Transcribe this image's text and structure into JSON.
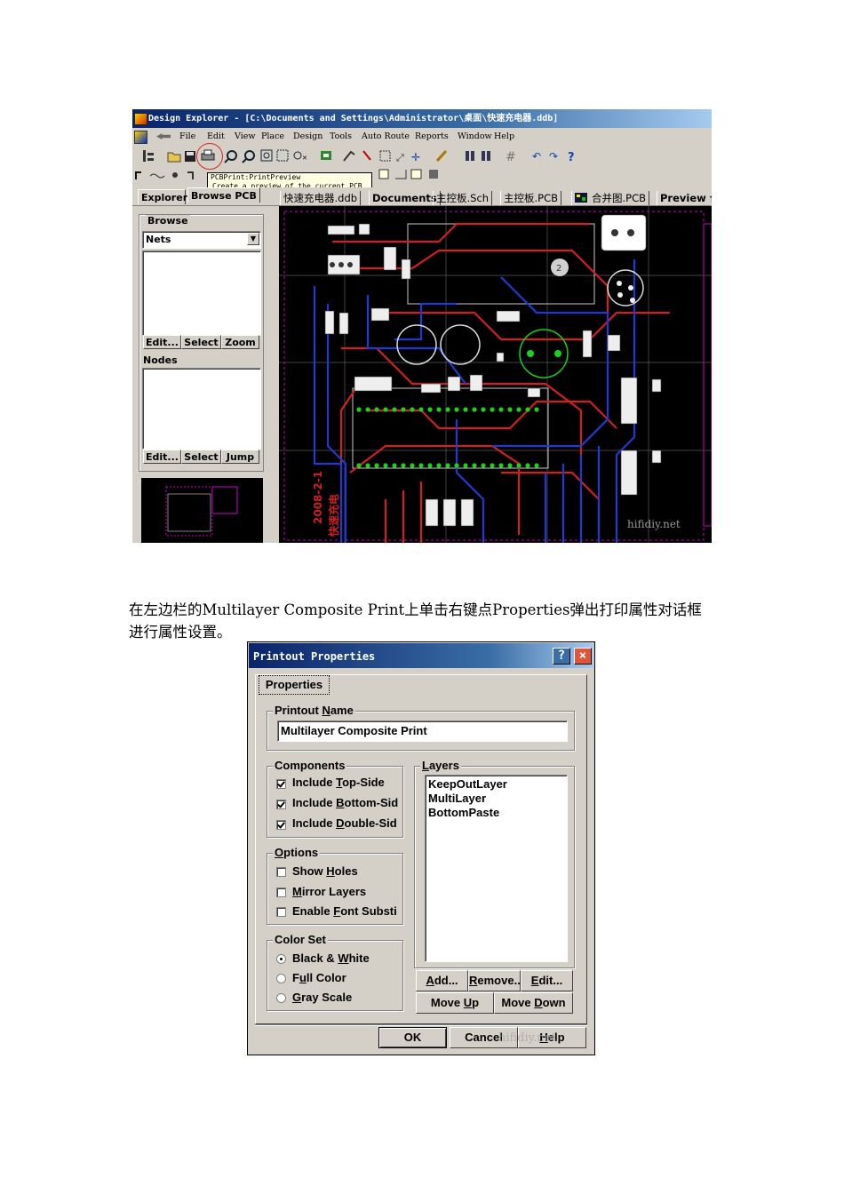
{
  "screenshot1": {
    "title": "Design Explorer - [C:\\Documents and Settings\\Administrator\\桌面\\快速充电器.ddb]",
    "menu": [
      "File",
      "Edit",
      "View",
      "Place",
      "Design",
      "Tools",
      "Auto Route",
      "Reports",
      "Window",
      "Help"
    ],
    "tooltip": {
      "line1": "PCBPrint:PrintPreview",
      "line2": "Create a preview of the current PCB"
    },
    "panel_tabs": [
      "Explorer",
      "Browse PCB"
    ],
    "doc_tabs": [
      "快速充电器.ddb",
      "Documents",
      "主控板.Sch",
      "主控板.PCB",
      "合并图.PCB",
      "Preview 合"
    ],
    "browse": {
      "label": "Browse",
      "selected": "Nets",
      "buttons": [
        "Edit...",
        "Select",
        "Zoom"
      ],
      "nodes_label": "Nodes",
      "nodes_buttons": [
        "Edit...",
        "Select",
        "Jump"
      ]
    },
    "pcb_text": {
      "vertical1": "2008-2-1",
      "vertical2": "快速充电",
      "pad_label": "2"
    },
    "watermark": "hifidiy.net"
  },
  "paragraph": "在左边栏的Multilayer Composite Print上单击右键点Properties弹出打印属性对话框进行属性设置。",
  "dialog": {
    "title": "Printout Properties",
    "help_btn": "?",
    "close_btn": "×",
    "tab": "Properties",
    "printout_name_label": "Printout Name",
    "printout_name_value": "Multilayer Composite Print",
    "components": {
      "label": "Components",
      "items": [
        {
          "label": "Include Top-Side",
          "checked": true
        },
        {
          "label": "Include Bottom-Sid",
          "checked": true
        },
        {
          "label": "Include Double-Sid",
          "checked": true
        }
      ]
    },
    "options": {
      "label": "Options",
      "items": [
        {
          "label": "Show Holes",
          "checked": false
        },
        {
          "label": "Mirror Layers",
          "checked": false
        },
        {
          "label": "Enable Font Substi",
          "checked": false
        }
      ]
    },
    "color_set": {
      "label": "Color Set",
      "items": [
        {
          "label": "Black & White",
          "selected": true
        },
        {
          "label": "Full Color",
          "selected": false
        },
        {
          "label": "Gray Scale",
          "selected": false
        }
      ]
    },
    "layers": {
      "label": "Layers",
      "items": [
        "KeepOutLayer",
        "MultiLayer",
        "BottomPaste"
      ]
    },
    "layer_buttons": {
      "add": "Add...",
      "remove": "Remove...",
      "edit": "Edit...",
      "move_up": "Move Up",
      "move_down": "Move Down"
    },
    "footer_buttons": {
      "ok": "OK",
      "cancel": "Cancel",
      "help": "Help"
    },
    "watermark": "hifidiy.net"
  }
}
